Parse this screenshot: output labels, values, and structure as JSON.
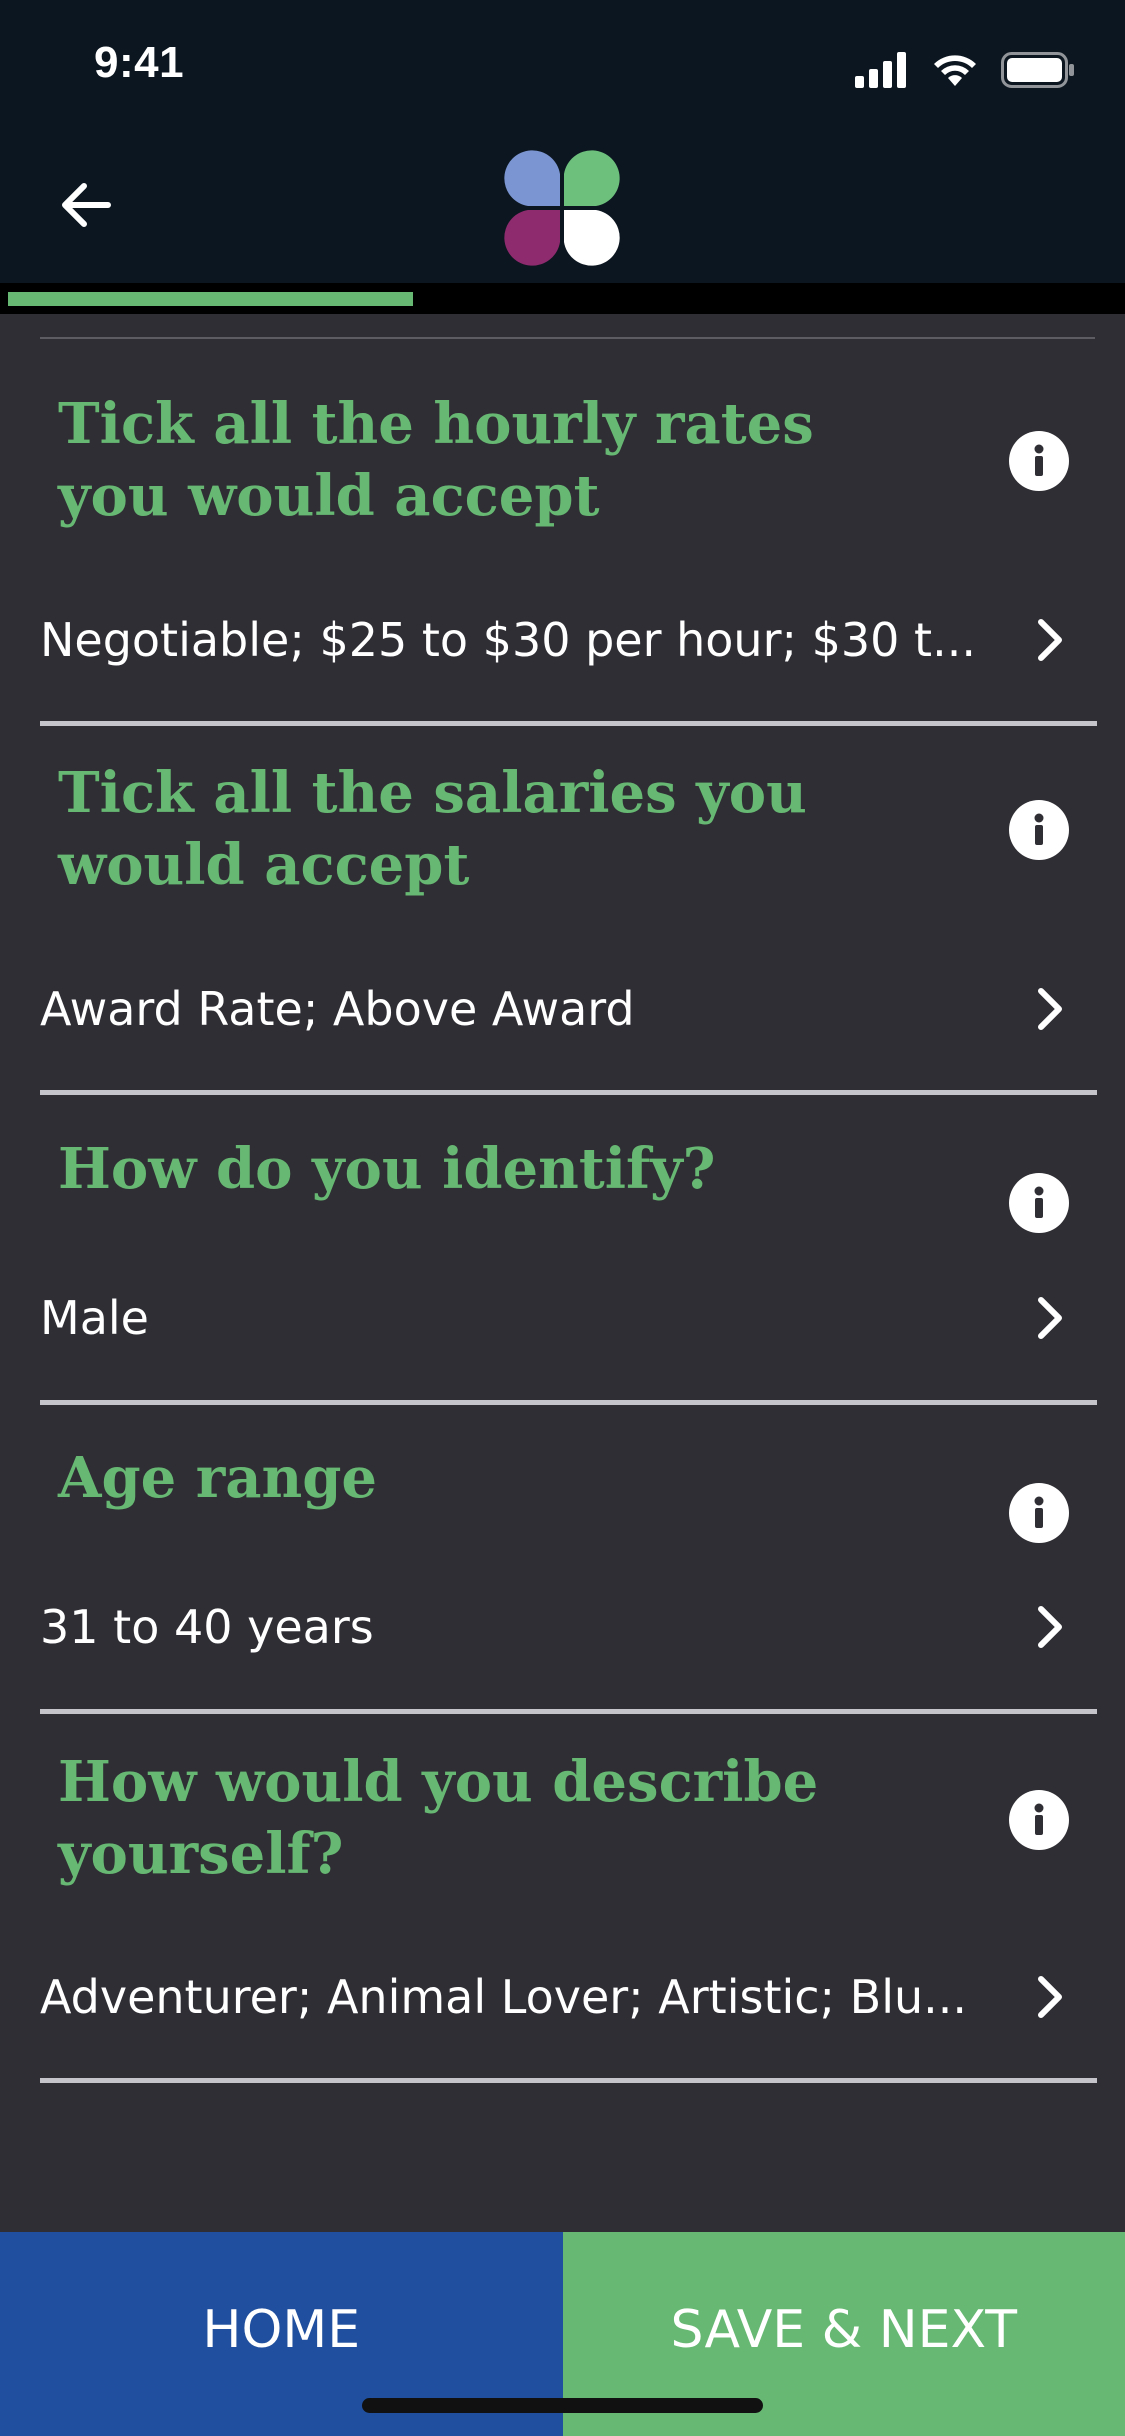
{
  "status_bar": {
    "time": "9:41"
  },
  "header": {
    "back_icon": "arrow-left-icon",
    "logo_icon": "four-petal-logo",
    "logo_colors": [
      "#7a95d1",
      "#6cc07c",
      "#8e2a6e",
      "#ffffff"
    ]
  },
  "progress": {
    "fraction": 0.36,
    "color": "#67b873"
  },
  "sections": [
    {
      "question": "Tick all the hourly rates you would accept",
      "answer": "Negotiable; $25 to $30 per hour; $30 t..."
    },
    {
      "question": "Tick all the salaries you would accept",
      "answer": "Award Rate; Above Award"
    },
    {
      "question": "How do you identify?",
      "answer": "Male"
    },
    {
      "question": "Age range",
      "answer": "31 to 40 years"
    },
    {
      "question": "How would you describe yourself?",
      "answer": "Adventurer; Animal Lover; Artistic; Blu..."
    }
  ],
  "bottom": {
    "home_label": "HOME",
    "next_label": "SAVE & NEXT"
  },
  "colors": {
    "accent_green": "#67b873",
    "home_blue": "#1f4f9e",
    "background": "#2f2e34",
    "header": "#0c1620"
  }
}
